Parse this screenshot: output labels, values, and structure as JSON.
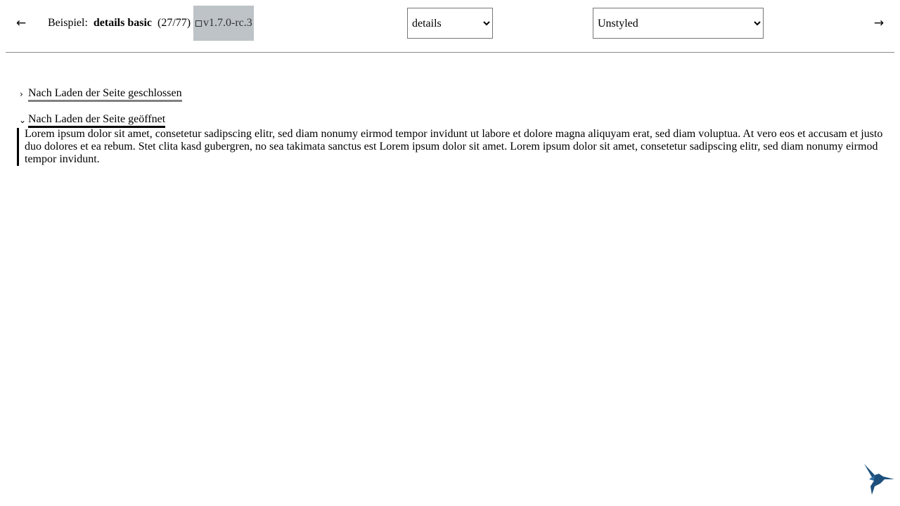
{
  "toolbar": {
    "prev_icon": "←",
    "next_icon": "→",
    "example_prefix": "Beispiel:",
    "example_name": "details basic",
    "example_count": "(27/77)",
    "version": "v1.7.0-rc.3",
    "badge_color": "#bdc3c7"
  },
  "component_select": {
    "selected": "details",
    "options": [
      "details"
    ]
  },
  "theme_select": {
    "selected": "Unstyled",
    "options": [
      "Unstyled"
    ]
  },
  "details": [
    {
      "summary": "Nach Laden der Seite geschlossen",
      "open": false,
      "chevron": "›"
    },
    {
      "summary": "Nach Laden der Seite geöffnet",
      "open": true,
      "chevron": "⌄",
      "content": "Lorem ipsum dolor sit amet, consetetur sadipscing elitr, sed diam nonumy eirmod tempor invidunt ut labore et dolore magna aliquyam erat, sed diam voluptua. At vero eos et accusam et justo duo dolores et ea rebum. Stet clita kasd gubergren, no sea takimata sanctus est Lorem ipsum dolor sit amet. Lorem ipsum dolor sit amet, consetetur sadipscing elitr, sed diam nonumy eirmod tempor invidunt."
    }
  ],
  "logo": {
    "icon": "hummingbird-icon",
    "color": "#1d4f7c"
  }
}
